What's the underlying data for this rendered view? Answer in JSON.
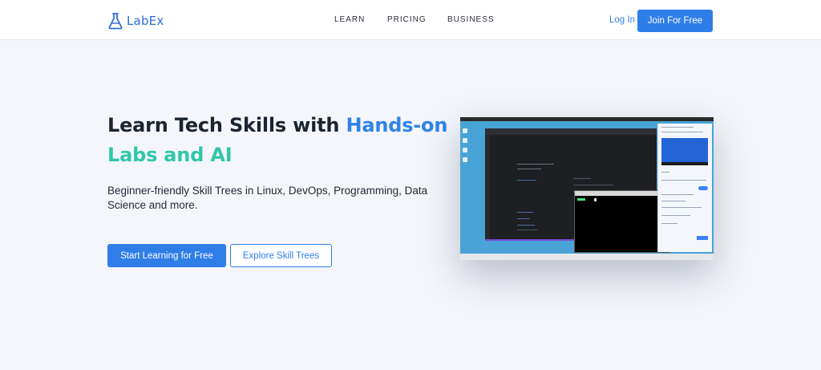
{
  "header": {
    "logo_text": "LabEx",
    "nav": [
      "LEARN",
      "PRICING",
      "BUSINESS"
    ],
    "login_label": "Log In",
    "join_label": "Join For Free"
  },
  "hero": {
    "title_part1": "Learn Tech Skills with ",
    "title_highlight1": "Hands-on",
    "title_highlight2": "Labs and AI",
    "subtitle": "Beginner-friendly Skill Trees in Linux, DevOps, Programming, Data Science and more.",
    "primary_cta": "Start Learning for Free",
    "secondary_cta": "Explore Skill Trees"
  },
  "colors": {
    "accent": "#2f7ee8",
    "highlight_blue": "#2f83e8",
    "highlight_green": "#2fc7a9",
    "page_bg": "#f4f6fb"
  },
  "icons": {
    "logo": "flask-icon"
  }
}
